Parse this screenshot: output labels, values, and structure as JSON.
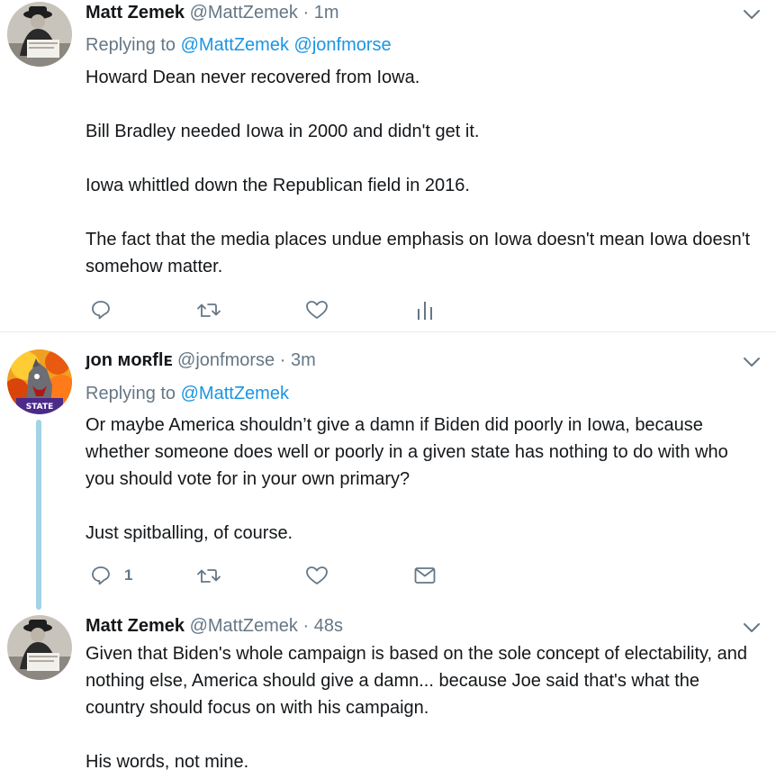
{
  "tweets": [
    {
      "name": "Matt Zemek",
      "handle": "@MattZemek",
      "separator": "·",
      "time": "1m",
      "replying_label": "Replying to",
      "replying_to": [
        "@MattZemek",
        "@jonfmorse"
      ],
      "paragraphs": [
        "Howard Dean never recovered from Iowa.",
        "Bill Bradley needed Iowa in 2000 and didn't get it.",
        "Iowa whittled down the Republican field in 2016.",
        "The fact that the media places undue emphasis on Iowa doesn't mean Iowa doesn't somehow matter."
      ],
      "actions": [
        "reply-icon",
        "retweet-icon",
        "like-icon",
        "analytics-icon"
      ]
    },
    {
      "name": "ȷon ᴍᴏʀﬂᴇ",
      "handle": "@jonfmorse",
      "separator": "·",
      "time": "3m",
      "replying_label": "Replying to",
      "replying_to": [
        "@MattZemek"
      ],
      "paragraphs": [
        "Or maybe America shouldn’t give a damn if Biden did poorly in Iowa, because whether someone does well or poorly in a given state has nothing to do with who you should vote for in your own primary?",
        "Just spitballing, of course."
      ],
      "reply_count": "1",
      "actions": [
        "reply-icon",
        "retweet-icon",
        "like-icon",
        "message-icon"
      ]
    },
    {
      "name": "Matt Zemek",
      "handle": "@MattZemek",
      "separator": "·",
      "time": "48s",
      "paragraphs": [
        "Given that Biden's whole campaign is based on the sole concept of electability, and nothing else, America should give a damn... because Joe said that's what the country should focus on with his campaign.",
        "His words, not mine."
      ]
    }
  ],
  "colors": {
    "link": "#1b95e0",
    "muted": "#657786",
    "text": "#14171a",
    "thread_line": "#a4d3e6",
    "divider": "#e6ecf0"
  }
}
